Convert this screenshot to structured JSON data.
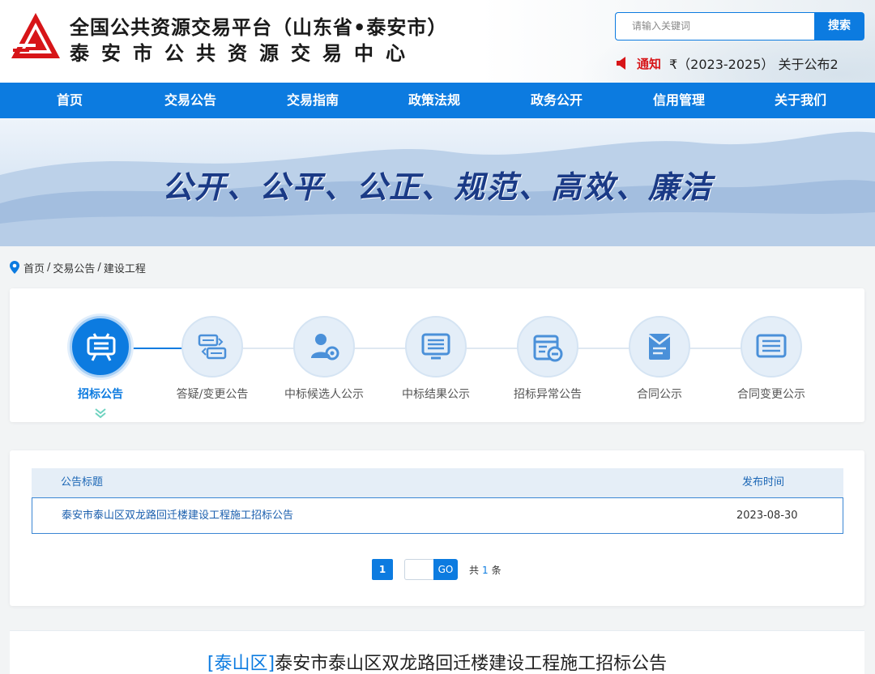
{
  "header": {
    "title_line1": "全国公共资源交易平台（山东省•泰安市）",
    "title_line2": "泰安市公共资源交易中心",
    "search": {
      "placeholder": "请输入关键词",
      "button_label": "搜索"
    },
    "notice": {
      "tag": "通知",
      "text": "₹（2023-2025）  关于公布2"
    }
  },
  "nav": {
    "items": [
      "首页",
      "交易公告",
      "交易指南",
      "政策法规",
      "政务公开",
      "信用管理",
      "关于我们"
    ]
  },
  "banner": {
    "slogan": "公开、公平、公正、规范、高效、廉洁"
  },
  "breadcrumb": {
    "home": "首页",
    "sep1": "/",
    "level2": "交易公告",
    "sep2": "/",
    "level3": "建设工程"
  },
  "categories": {
    "items": [
      {
        "label": "招标公告",
        "icon": "billboard-icon",
        "active": true
      },
      {
        "label": "答疑/变更公告",
        "icon": "swap-cards-icon",
        "active": false
      },
      {
        "label": "中标候选人公示",
        "icon": "person-gear-icon",
        "active": false
      },
      {
        "label": "中标结果公示",
        "icon": "monitor-list-icon",
        "active": false
      },
      {
        "label": "招标异常公告",
        "icon": "calendar-minus-icon",
        "active": false
      },
      {
        "label": "合同公示",
        "icon": "contract-envelope-icon",
        "active": false
      },
      {
        "label": "合同变更公示",
        "icon": "screen-list-icon",
        "active": false
      }
    ],
    "accent": "#0c7be0"
  },
  "table": {
    "col_title": "公告标题",
    "col_date": "发布时间",
    "rows": [
      {
        "title": "泰安市泰山区双龙路回迁楼建设工程施工招标公告",
        "date": "2023-08-30"
      }
    ]
  },
  "pager": {
    "current": "1",
    "go_label": "GO",
    "total_prefix": "共",
    "total": "1",
    "total_suffix": "条"
  },
  "article": {
    "area": "[泰山区]",
    "title": "泰安市泰山区双龙路回迁楼建设工程施工招标公告"
  }
}
